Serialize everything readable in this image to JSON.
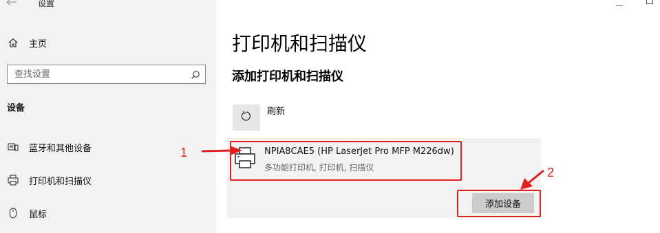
{
  "window": {
    "app_title": "设置",
    "back_icon": "back-arrow-icon",
    "controls": [
      "minimize-icon",
      "maximize-icon"
    ]
  },
  "sidebar": {
    "home_label": "主页",
    "search_placeholder": "查找设置",
    "section_title": "设备",
    "items": [
      {
        "label": "蓝牙和其他设备",
        "icon": "bluetooth-devices-icon"
      },
      {
        "label": "打印机和扫描仪",
        "icon": "printer-icon"
      },
      {
        "label": "鼠标",
        "icon": "mouse-icon"
      }
    ]
  },
  "main": {
    "page_title": "打印机和扫描仪",
    "add_section_title": "添加打印机和扫描仪",
    "refresh_label": "刷新",
    "device": {
      "name": "NPIA8CAE5 (HP LaserJet Pro MFP M226dw)",
      "type": "多功能打印机, 打印机, 扫描仪"
    },
    "add_device_button": "添加设备"
  },
  "annotations": {
    "step1": "1",
    "step2": "2",
    "color": "#e02020"
  }
}
